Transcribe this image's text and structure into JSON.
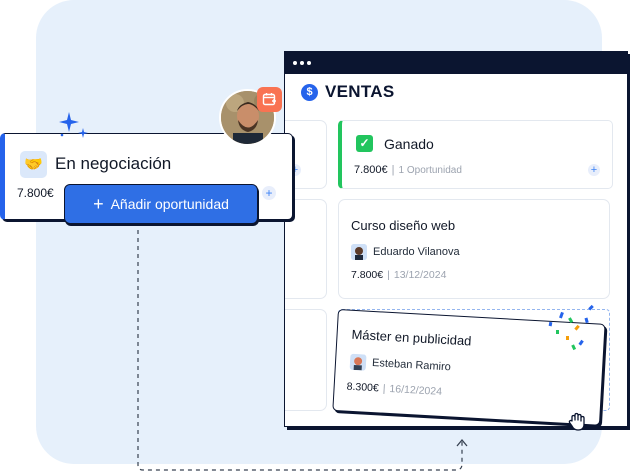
{
  "window": {
    "title": "VENTAS"
  },
  "columns": {
    "ganado": {
      "title": "Ganado",
      "amount": "7.800€",
      "separator": "|",
      "count": "1 Oportunidad"
    }
  },
  "cards": {
    "curso": {
      "title": "Curso diseño web",
      "owner": "Eduardo Vilanova",
      "amount": "7.800€",
      "separator": "|",
      "date": "13/12/2024"
    },
    "master": {
      "title": "Máster en publicidad",
      "owner": "Esteban Ramiro",
      "amount": "8.300€",
      "separator": "|",
      "date": "16/12/2024"
    }
  },
  "negotiation": {
    "title": "En negociación",
    "amount": "7.800€",
    "add_button_label": "Añadir oportunidad",
    "add_button_icon": "+"
  },
  "colors": {
    "accent_blue": "#2f6fe5",
    "dark_navy": "#0b1530",
    "success_green": "#22c55e",
    "background_panel": "#e6f0fb",
    "badge_orange": "#f97352"
  },
  "icons": {
    "currency": "dollar-icon",
    "won": "check-icon",
    "negotiation": "handshake-icon",
    "badge": "calendar-icon",
    "cursor": "grab-hand-icon"
  }
}
